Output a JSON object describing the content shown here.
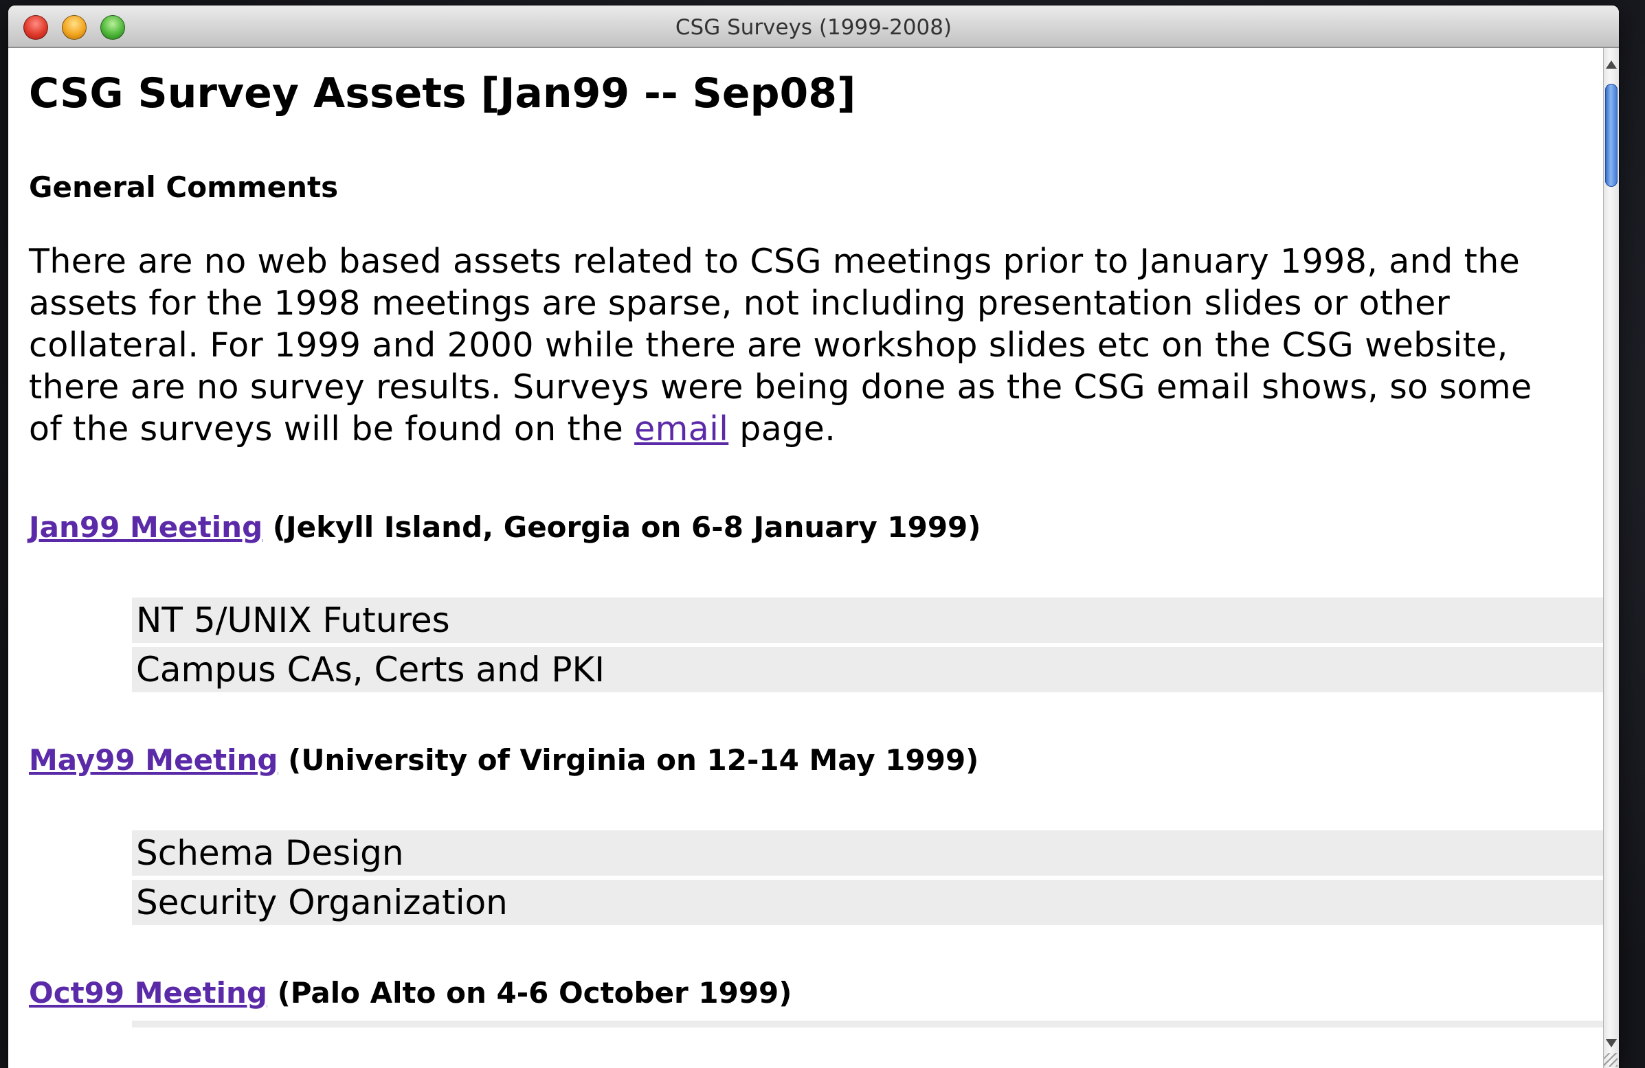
{
  "window": {
    "title": "CSG Surveys (1999-2008)"
  },
  "page": {
    "title": "CSG Survey Assets [Jan99 -- Sep08]",
    "section_heading": "General Comments",
    "intro_lines": [
      "There are no web based assets related to CSG meetings prior to January 1998, and the",
      "assets for the 1998 meetings are sparse, not including presentation slides or other",
      "collateral. For 1999 and 2000 while there are workshop slides etc on the CSG website,",
      "there are no survey results. Surveys were being done as the CSG email shows, so some"
    ],
    "intro_last_prefix": "of the surveys will be found on the ",
    "intro_link": "email",
    "intro_last_suffix": " page."
  },
  "meetings": [
    {
      "link": "Jan99 Meeting",
      "detail": " (Jekyll Island, Georgia on 6-8 January 1999)",
      "surveys": [
        "NT 5/UNIX Futures",
        "Campus CAs, Certs and PKI"
      ]
    },
    {
      "link": "May99 Meeting",
      "detail": " (University of Virginia on 12-14 May 1999)",
      "surveys": [
        "Schema Design",
        "Security Organization"
      ]
    },
    {
      "link": "Oct99 Meeting",
      "detail": " (Palo Alto on 4-6 October 1999)",
      "surveys": []
    }
  ],
  "colors": {
    "link": "#5b2aa8",
    "row_background": "#ececec"
  }
}
